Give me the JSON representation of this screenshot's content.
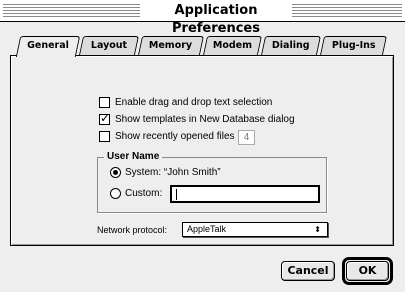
{
  "window": {
    "title": "Application Preferences"
  },
  "tabs": [
    {
      "label": "General",
      "active": true
    },
    {
      "label": "Layout",
      "active": false
    },
    {
      "label": "Memory",
      "active": false
    },
    {
      "label": "Modem",
      "active": false
    },
    {
      "label": "Dialing",
      "active": false
    },
    {
      "label": "Plug-Ins",
      "active": false
    }
  ],
  "general": {
    "options": [
      {
        "label": "Enable drag and drop text selection",
        "checked": false
      },
      {
        "label": "Show templates in New Database dialog",
        "checked": true
      },
      {
        "label": "Show recently opened files :",
        "checked": false
      }
    ],
    "recent_files_count": "4",
    "user_name": {
      "title": "User Name",
      "system_label": "System: “John Smith”",
      "custom_label": "Custom:",
      "custom_value": "",
      "selected": "system"
    },
    "network_protocol": {
      "label": "Network protocol:",
      "value": "AppleTalk"
    }
  },
  "buttons": {
    "cancel": "Cancel",
    "ok": "OK"
  }
}
